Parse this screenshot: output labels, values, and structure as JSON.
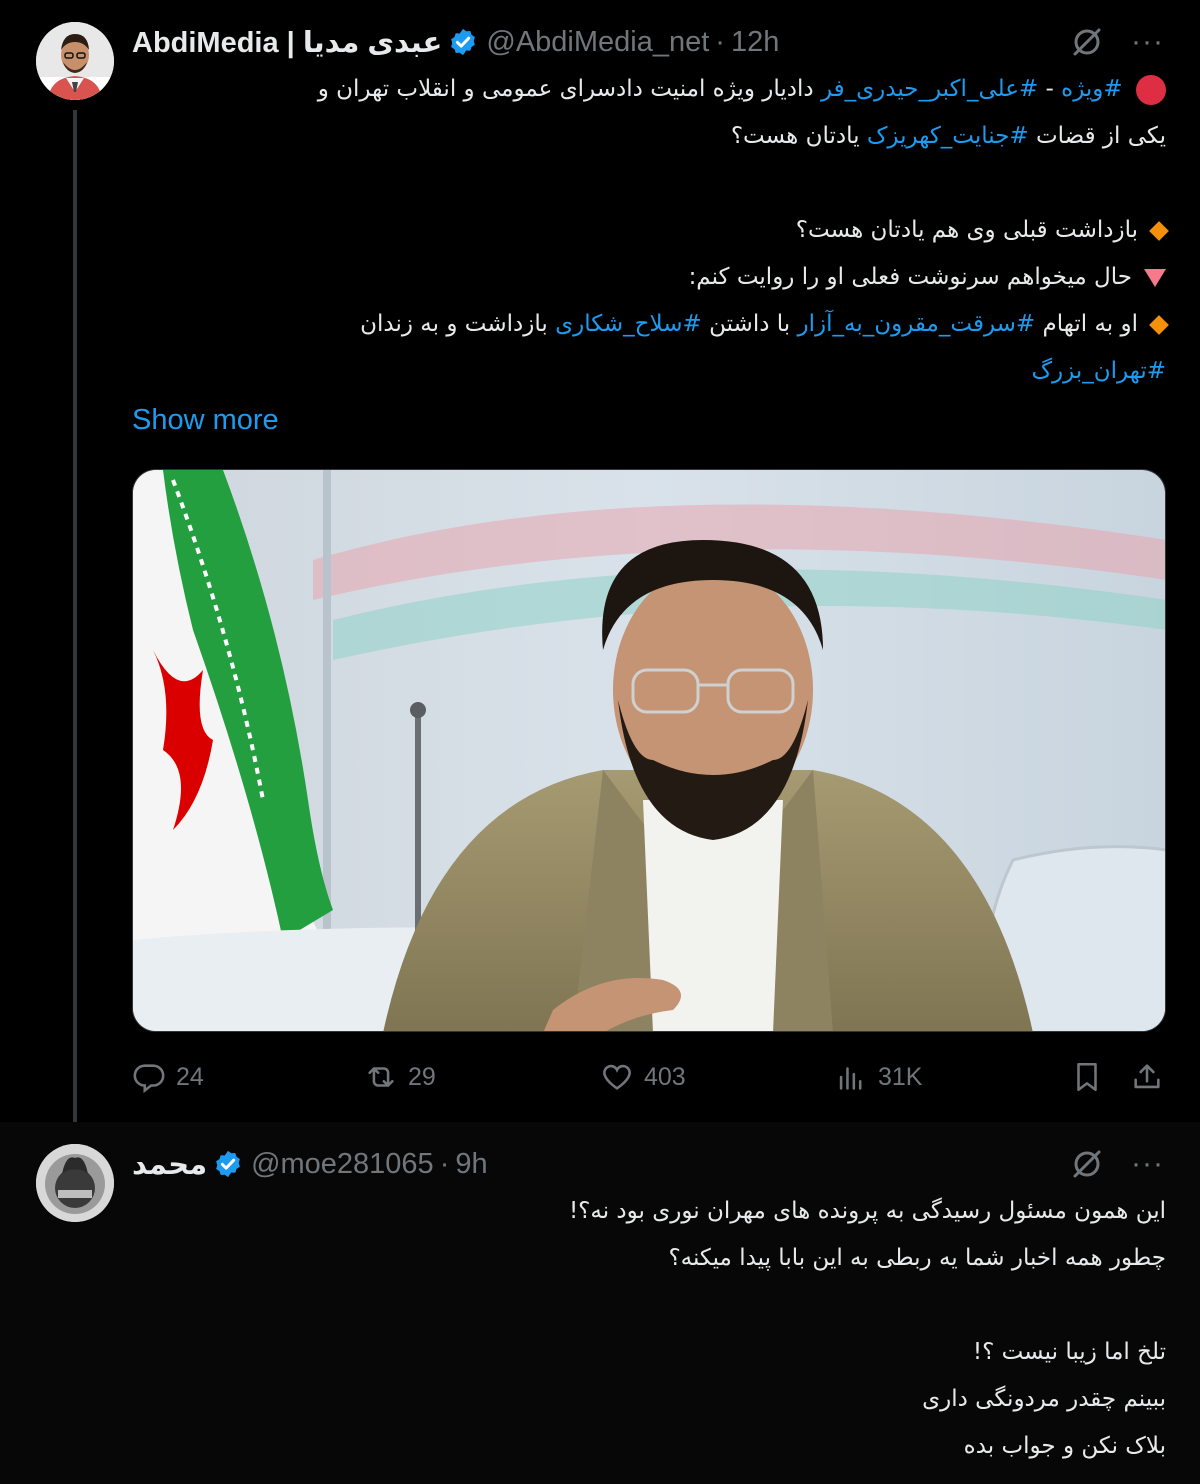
{
  "tweet1": {
    "author": {
      "display_name": "AbdiMedia | عبدی مدیا",
      "handle": "@AbdiMedia_net",
      "separator": "·",
      "time": "12h"
    },
    "lines": [
      {
        "parts": [
          {
            "t": "#ویژه",
            "tag": true
          },
          {
            "t": " - ",
            "tag": false
          },
          {
            "t": "#علی_اکبر_حیدری_فر",
            "tag": true
          },
          {
            "t": " دادیار ویژه امنیت دادسرای عمومی و انقلاب تهران و",
            "tag": false
          }
        ]
      },
      {
        "parts": [
          {
            "t": "یکی از قضات ",
            "tag": false
          },
          {
            "t": "#جنایت_کهریزک",
            "tag": true
          },
          {
            "t": " یادتان هست؟",
            "tag": false
          }
        ]
      },
      {
        "parts": []
      },
      {
        "parts": [
          {
            "t": "بازداشت قبلی وی هم یادتان هست؟",
            "tag": false
          }
        ]
      },
      {
        "parts": [
          {
            "t": "حال میخواهم سرنوشت فعلی او را روایت کنم:",
            "tag": false
          }
        ]
      },
      {
        "parts": [
          {
            "t": "او به اتهام ",
            "tag": false
          },
          {
            "t": "#سرقت_مقرون_به_آزار",
            "tag": true
          },
          {
            "t": " با داشتن ",
            "tag": false
          },
          {
            "t": "#سلاح_شکاری",
            "tag": true
          },
          {
            "t": " بازداشت و به زندان",
            "tag": false
          }
        ]
      },
      {
        "parts": [
          {
            "t": "#تهران_بزرگ",
            "tag": true
          }
        ]
      }
    ],
    "show_more": "Show more",
    "stats": {
      "replies": "24",
      "reposts": "29",
      "likes": "403",
      "views": "31K"
    }
  },
  "tweet2": {
    "author": {
      "display_name": "محمد",
      "handle": "@moe281065",
      "separator": "·",
      "time": "9h"
    },
    "lines": [
      "این همون مسئول رسیدگی به پرونده های مهران نوری بود نه؟!",
      "چطور همه اخبار شما یه ربطی به این بابا پیدا میکنه؟",
      "",
      "تلخ اما زیبا نیست ؟!",
      "ببینم چقدر مردونگی داری",
      "بلاک نکن و جواب بده"
    ]
  },
  "colors": {
    "link": "#1d9bf0",
    "muted": "#71767b",
    "text": "#e7e9ea",
    "verified": "#1d9bf0"
  },
  "icons": [
    "grok-icon",
    "more-icon",
    "reply-icon",
    "repost-icon",
    "like-icon",
    "views-icon",
    "bookmark-icon",
    "share-icon",
    "verified-badge-icon"
  ]
}
